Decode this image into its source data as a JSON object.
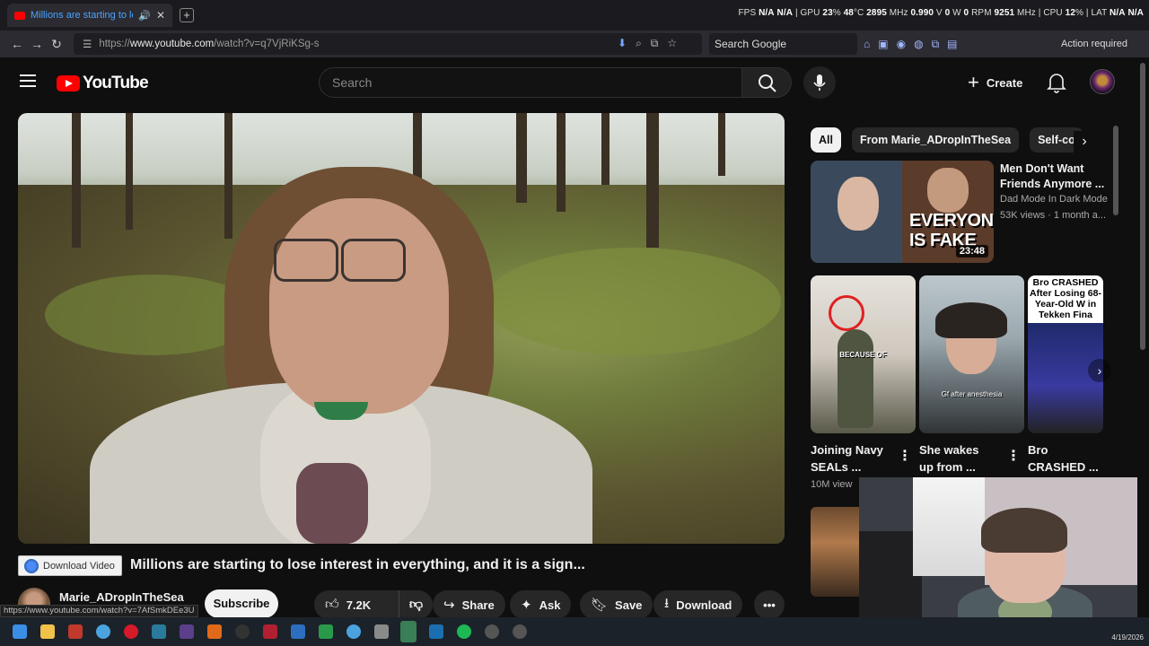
{
  "browser": {
    "tab_title": "Millions are starting to lose i",
    "url_prefix": "https://",
    "url_host": "www.youtube.com",
    "url_path": "/watch?v=q7VjRiKSg-s",
    "search_engine": "Search Google",
    "action_required": "Action required",
    "status_url": "https://www.youtube.com/watch?v=7AfSmkDEe3U"
  },
  "hud": {
    "fps_label": "FPS",
    "fps": "N/A",
    "fps2": "N/A",
    "gpu_label": "GPU",
    "gpu_pct": "23",
    "gpu_temp": "48",
    "gpu_clock": "2895",
    "gpu_volt": "0.990",
    "gpu_power": "0",
    "fan": "0",
    "mem_clock": "9251",
    "cpu_label": "CPU",
    "cpu_pct": "12",
    "lat_label": "LAT",
    "lat": "N/A",
    "lat2": "N/A"
  },
  "yt": {
    "logo": "YouTube",
    "search_placeholder": "Search",
    "create": "Create"
  },
  "video": {
    "title": "Millions are starting to lose interest in everything, and it is a sign...",
    "channel": "Marie_ADropInTheSea",
    "subscribe": "Subscribe",
    "likes": "7.2K",
    "share": "Share",
    "ask": "Ask",
    "save": "Save",
    "download": "Download",
    "download_video_ext": "Download Video"
  },
  "chips": [
    "All",
    "From Marie_ADropInTheSea",
    "Self-co"
  ],
  "recs": {
    "first": {
      "title": "Men Don't Want Friends Anymore ...",
      "channel": "Dad Mode In Dark Mode",
      "meta": "53K views · 1 month a...",
      "duration": "23:48",
      "thumb_text_1": "EVERYONE",
      "thumb_text_2": "IS FAKE"
    },
    "shorts": [
      {
        "title_1": "Joining Navy",
        "title_2": "SEALs ...",
        "caption": "BECAUSE OF"
      },
      {
        "title_1": "She wakes",
        "title_2": "up from ...",
        "caption": "Gf after anesthesia"
      },
      {
        "title_1": "Bro",
        "title_2": "CRASHED ...",
        "caption": "Bro CRASHED After Losing 68-Year-Old W in Tekken Fina"
      }
    ],
    "views": "10M view"
  },
  "taskbar": {
    "date": "4/19/2026"
  },
  "colors": {
    "yt_red": "#ff0000",
    "background": "#0f0f0f",
    "pill": "#272727",
    "accent_blue": "#4da3ff"
  }
}
